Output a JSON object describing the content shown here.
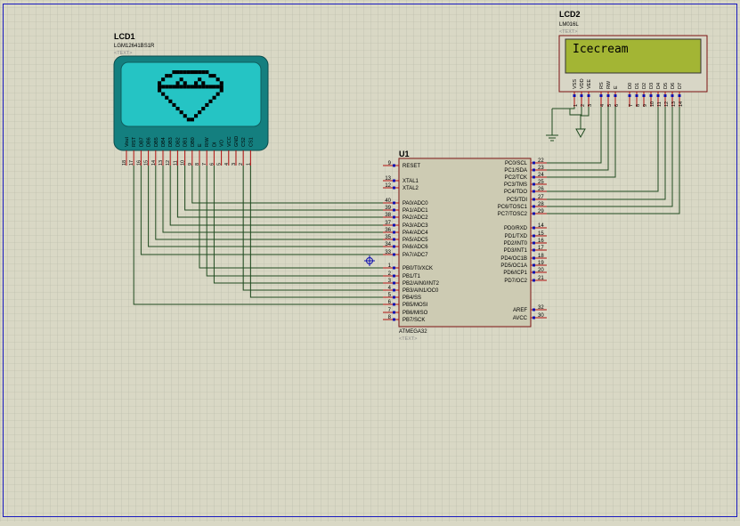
{
  "colors": {
    "background": "#d9d8c5",
    "grid": "#b6b5a6",
    "border": "#1a1abf",
    "wire": "#1f4a1f",
    "chip_fill": "#cdcbb3",
    "chip_stroke": "#7a1010",
    "glcd_body": "#147f7f",
    "glcd_screen": "#25c4c4",
    "lcd_body": "#d8d6c6",
    "lcd_screen": "#a3b534",
    "pin_red": "#b01010",
    "pin_blue": "#1010b0"
  },
  "lcd1": {
    "ref": "LCD1",
    "part": "LGM12641BS1R",
    "text_placeholder": "<TEXT>",
    "pin_names": [
      "Vout",
      "RST",
      "DB7",
      "DB6",
      "DB5",
      "DB4",
      "DB3",
      "DB2",
      "DB1",
      "DB0",
      "E",
      "R/W",
      "DI",
      "VO",
      "VCC",
      "GND",
      "CS2",
      "CS1"
    ],
    "pin_numbers": [
      "18",
      "17",
      "16",
      "15",
      "14",
      "13",
      "12",
      "11",
      "10",
      "9",
      "8",
      "7",
      "6",
      "5",
      "4",
      "3",
      "2",
      "1"
    ]
  },
  "lcd2": {
    "ref": "LCD2",
    "part": "LM016L",
    "text_placeholder": "<TEXT>",
    "display_text": "Icecream",
    "pin_names": [
      "VSS",
      "VDD",
      "VEE",
      "RS",
      "RW",
      "E",
      "D0",
      "D1",
      "D2",
      "D3",
      "D4",
      "D5",
      "D6",
      "D7"
    ],
    "pin_numbers": [
      "1",
      "2",
      "3",
      "4",
      "5",
      "6",
      "7",
      "8",
      "9",
      "10",
      "11",
      "12",
      "13",
      "14"
    ]
  },
  "u1": {
    "ref": "U1",
    "part": "ATMEGA32",
    "text_placeholder": "<TEXT>",
    "left_pins": [
      {
        "num": "9",
        "name": "RESET"
      },
      {
        "num": "13",
        "name": "XTAL1"
      },
      {
        "num": "12",
        "name": "XTAL2"
      },
      {
        "num": "40",
        "name": "PA0/ADC0"
      },
      {
        "num": "39",
        "name": "PA1/ADC1"
      },
      {
        "num": "38",
        "name": "PA2/ADC2"
      },
      {
        "num": "37",
        "name": "PA3/ADC3"
      },
      {
        "num": "36",
        "name": "PA4/ADC4"
      },
      {
        "num": "35",
        "name": "PA5/ADC5"
      },
      {
        "num": "34",
        "name": "PA6/ADC6"
      },
      {
        "num": "33",
        "name": "PA7/ADC7"
      },
      {
        "num": "1",
        "name": "PB0/T0/XCK"
      },
      {
        "num": "2",
        "name": "PB1/T1"
      },
      {
        "num": "3",
        "name": "PB2/AIN0/INT2"
      },
      {
        "num": "4",
        "name": "PB3/AIN1/OC0"
      },
      {
        "num": "5",
        "name": "PB4/SS"
      },
      {
        "num": "6",
        "name": "PB5/MOSI"
      },
      {
        "num": "7",
        "name": "PB6/MISO"
      },
      {
        "num": "8",
        "name": "PB7/SCK"
      }
    ],
    "right_pins": [
      {
        "num": "22",
        "name": "PC0/SCL"
      },
      {
        "num": "23",
        "name": "PC1/SDA"
      },
      {
        "num": "24",
        "name": "PC2/TCK"
      },
      {
        "num": "25",
        "name": "PC3/TMS"
      },
      {
        "num": "26",
        "name": "PC4/TDO"
      },
      {
        "num": "27",
        "name": "PC5/TDI"
      },
      {
        "num": "28",
        "name": "PC6/TOSC1"
      },
      {
        "num": "29",
        "name": "PC7/TOSC2"
      },
      {
        "num": "14",
        "name": "PD0/RXD"
      },
      {
        "num": "15",
        "name": "PD1/TXD"
      },
      {
        "num": "16",
        "name": "PD2/INT0"
      },
      {
        "num": "17",
        "name": "PD3/INT1"
      },
      {
        "num": "18",
        "name": "PD4/OC1B"
      },
      {
        "num": "19",
        "name": "PD5/OC1A"
      },
      {
        "num": "20",
        "name": "PD6/ICP1"
      },
      {
        "num": "21",
        "name": "PD7/OC2"
      },
      {
        "num": "32",
        "name": "AREF"
      },
      {
        "num": "30",
        "name": "AVCC"
      }
    ]
  },
  "icons": {
    "ground": "ground-icon",
    "potentiometer": "potentiometer-icon",
    "origin_marker": "origin-crosshair-icon",
    "glcd_image": "heart-icon"
  }
}
